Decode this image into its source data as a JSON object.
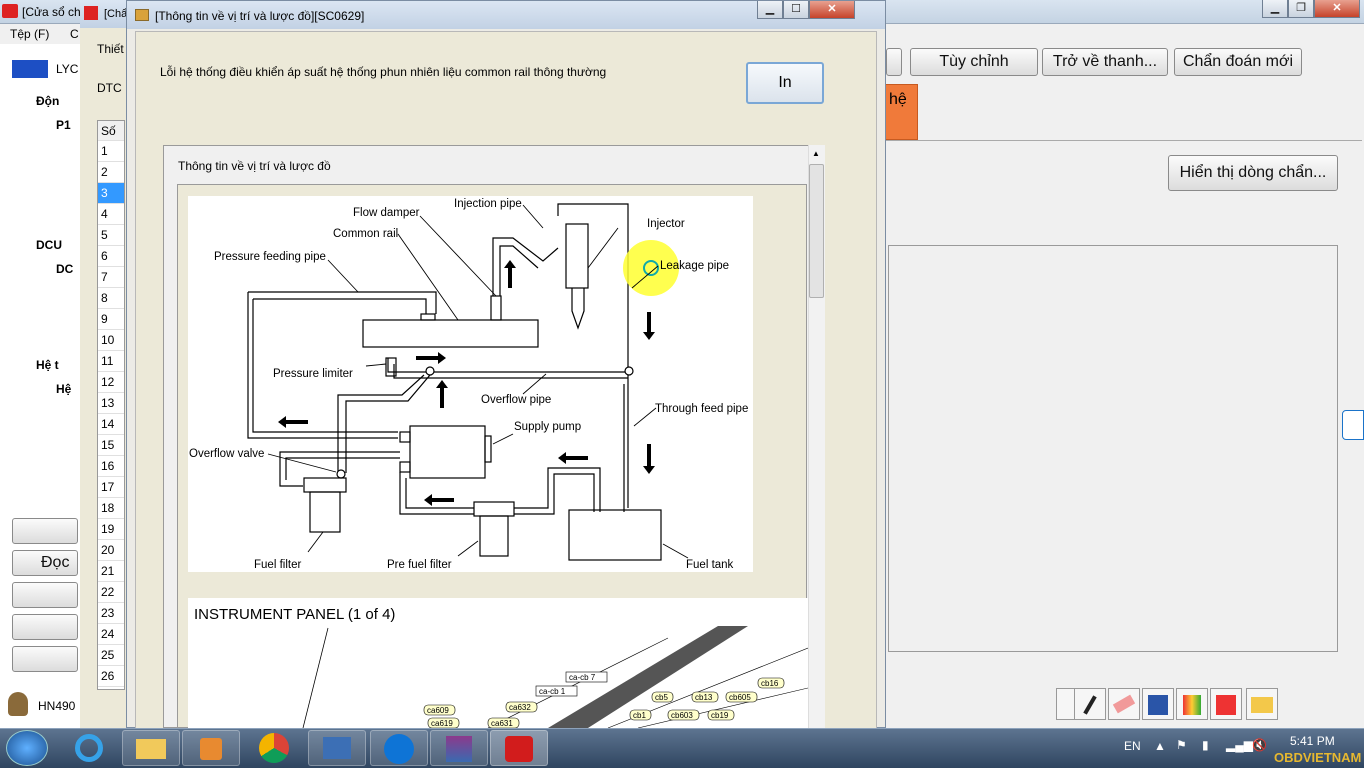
{
  "bg": {
    "title": "[Cửa sổ ch",
    "menu": [
      "Tệp (F)",
      "C"
    ],
    "logo_text": "LYC",
    "tree": [
      "Độn",
      "P1",
      "DCU",
      "DC",
      "Hệ t",
      "Hệ"
    ],
    "doc_button": "Đọc",
    "footer_text": "HN490",
    "buttons": {
      "custom": "Tùy chỉnh",
      "back": "Trở về thanh...",
      "new_diag": "Chẩn đoán mới",
      "show_line": "Hiển thị dòng chẩn..."
    },
    "orange_tab": "hệ"
  },
  "mid": {
    "title": "[Chẩ",
    "label_device": "Thiết",
    "label_dtc": "DTC",
    "col_header": "Số"
  },
  "rows": [
    "1",
    "2",
    "3",
    "4",
    "5",
    "6",
    "7",
    "8",
    "9",
    "10",
    "11",
    "12",
    "13",
    "14",
    "15",
    "16",
    "17",
    "18",
    "19",
    "20",
    "21",
    "22",
    "23",
    "24",
    "25",
    "26"
  ],
  "dialog": {
    "title": "[Thông tin về vị trí và lược đồ][SC0629]",
    "message": "Lỗi hệ thống điều khiển áp suất  hệ thống phun nhiên liệu common rail  thông thường",
    "print_button": "In",
    "section_title": "Thông tin về vị trí và lược đồ"
  },
  "diagram_labels": {
    "injection_pipe": "Injection pipe",
    "flow_damper": "Flow damper",
    "injector": "Injector",
    "common_rail": "Common rail",
    "leakage_pipe": "Leakage pipe",
    "pressure_feeding_pipe": "Pressure feeding pipe",
    "pressure_limiter": "Pressure limiter",
    "overflow_pipe": "Overflow pipe",
    "through_feed_pipe": "Through feed pipe",
    "supply_pump": "Supply pump",
    "overflow_valve": "Overflow valve",
    "fuel_filter": "Fuel filter",
    "pre_fuel_filter": "Pre fuel filter",
    "fuel_tank": "Fuel tank"
  },
  "panel": {
    "title": "INSTRUMENT PANEL (1 of 4)",
    "tags": [
      "ca-cb 7",
      "ca-cb 1",
      "ca609",
      "ca632",
      "ca619",
      "ca631",
      "cb5",
      "cb13",
      "cb605",
      "cb16",
      "cb1",
      "cb603",
      "cb19"
    ]
  },
  "taskbar": {
    "lang": "EN",
    "time": "5:41 PM",
    "watermark": "OBDVIETNAM"
  }
}
